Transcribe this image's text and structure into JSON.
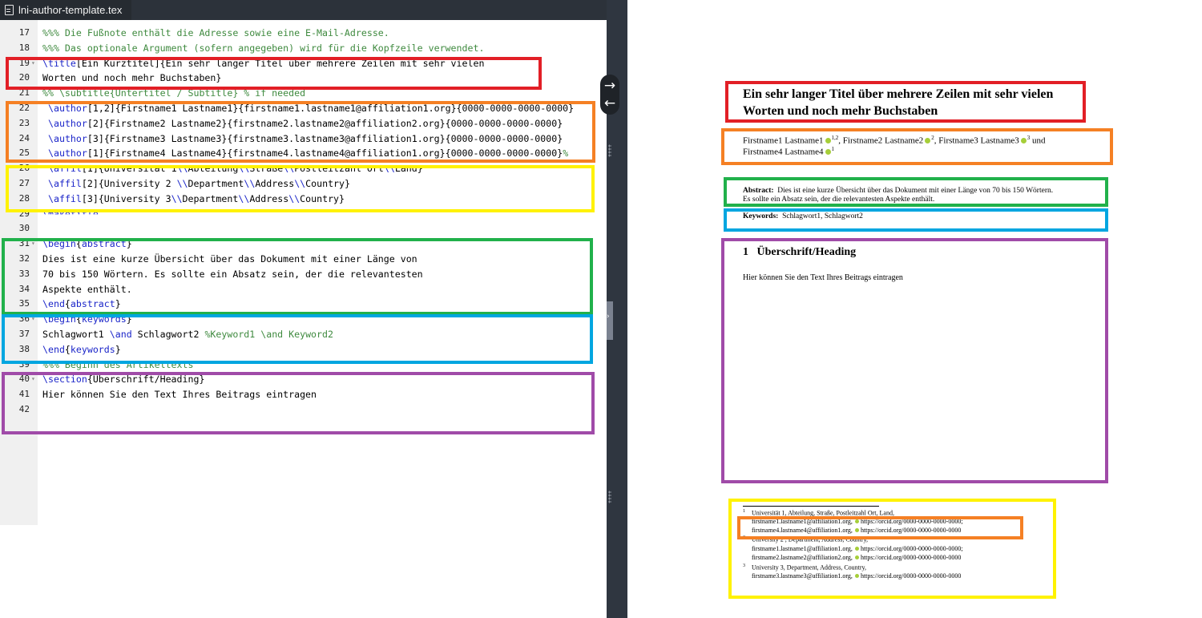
{
  "editor": {
    "tab_title": "lni-author-template.tex",
    "lines": [
      {
        "n": "17",
        "parts": [
          {
            "t": "%%% Die Fußnote enthält die Adresse sowie eine E-Mail-Adresse.",
            "c": "cm"
          }
        ]
      },
      {
        "n": "18",
        "parts": [
          {
            "t": "%%% Das optionale Argument (sofern angegeben) wird für die Kopfzeile verwendet.",
            "c": "cm"
          }
        ]
      },
      {
        "n": "19",
        "fold": true,
        "parts": [
          {
            "t": "\\title",
            "c": "kw"
          },
          {
            "t": "[Ein Kurztitel]{Ein sehr langer Titel über mehrere Zeilen mit sehr vielen"
          }
        ]
      },
      {
        "n": "20",
        "parts": [
          {
            "t": "Worten und noch mehr Buchstaben}"
          }
        ]
      },
      {
        "n": "21",
        "parts": [
          {
            "t": "%% \\subtitle{Untertitel / Subtitle} % if needed",
            "c": "cm"
          }
        ]
      },
      {
        "n": "22",
        "ind": true,
        "parts": [
          {
            "t": "\\author",
            "c": "kw"
          },
          {
            "t": "[1,2]{Firstname1 Lastname1}{firstname1.lastname1@affiliation1.org}{0000-0000-0000-0000}"
          }
        ]
      },
      {
        "n": "23",
        "ind": true,
        "parts": [
          {
            "t": "\\author",
            "c": "kw"
          },
          {
            "t": "[2]{Firstname2 Lastname2}{firstname2.lastname2@affiliation2.org}{0000-0000-0000-0000}"
          }
        ]
      },
      {
        "n": "24",
        "ind": true,
        "parts": [
          {
            "t": "\\author",
            "c": "kw"
          },
          {
            "t": "[3]{Firstname3 Lastname3}{firstname3.lastname3@affiliation1.org}{0000-0000-0000-0000}"
          }
        ]
      },
      {
        "n": "25",
        "ind": true,
        "parts": [
          {
            "t": "\\author",
            "c": "kw"
          },
          {
            "t": "[1]{Firstname4 Lastname4}{firstname4.lastname4@affiliation1.org}{0000-0000-0000-0000}"
          },
          {
            "t": "%",
            "c": "cm"
          }
        ]
      },
      {
        "n": "26",
        "ind": true,
        "cut": true,
        "parts": [
          {
            "t": "\\affil",
            "c": "kw"
          },
          {
            "t": "[1]{Universität 1"
          },
          {
            "t": "\\\\",
            "c": "kw"
          },
          {
            "t": "Abteilung"
          },
          {
            "t": "\\\\",
            "c": "kw"
          },
          {
            "t": "Straße"
          },
          {
            "t": "\\\\",
            "c": "kw"
          },
          {
            "t": "Postleitzahl Ort"
          },
          {
            "t": "\\\\",
            "c": "kw"
          },
          {
            "t": "Land}"
          }
        ]
      },
      {
        "n": "27",
        "ind": true,
        "parts": [
          {
            "t": "\\affil",
            "c": "kw"
          },
          {
            "t": "[2]{University 2 "
          },
          {
            "t": "\\\\",
            "c": "kw"
          },
          {
            "t": "Department"
          },
          {
            "t": "\\\\",
            "c": "kw"
          },
          {
            "t": "Address"
          },
          {
            "t": "\\\\",
            "c": "kw"
          },
          {
            "t": "Country}"
          }
        ]
      },
      {
        "n": "28",
        "ind": true,
        "parts": [
          {
            "t": "\\affil",
            "c": "kw"
          },
          {
            "t": "[3]{University 3"
          },
          {
            "t": "\\\\",
            "c": "kw"
          },
          {
            "t": "Department"
          },
          {
            "t": "\\\\",
            "c": "kw"
          },
          {
            "t": "Address"
          },
          {
            "t": "\\\\",
            "c": "kw"
          },
          {
            "t": "Country}"
          }
        ]
      },
      {
        "n": "29",
        "cutb": true,
        "parts": [
          {
            "t": "\\maketitle",
            "c": "kw"
          }
        ]
      },
      {
        "n": "30",
        "parts": []
      },
      {
        "n": "31",
        "fold": true,
        "parts": [
          {
            "t": "\\begin",
            "c": "kw"
          },
          {
            "t": "{"
          },
          {
            "t": "abstract",
            "c": "kw"
          },
          {
            "t": "}"
          }
        ]
      },
      {
        "n": "32",
        "parts": [
          {
            "t": "Dies ist eine kurze Übersicht über das Dokument mit einer Länge von"
          }
        ]
      },
      {
        "n": "33",
        "parts": [
          {
            "t": "70 bis 150 Wörtern. Es sollte ein Absatz sein, der die relevantesten"
          }
        ]
      },
      {
        "n": "34",
        "parts": [
          {
            "t": "Aspekte enthält."
          }
        ]
      },
      {
        "n": "35",
        "parts": [
          {
            "t": "\\end",
            "c": "kw"
          },
          {
            "t": "{"
          },
          {
            "t": "abstract",
            "c": "kw"
          },
          {
            "t": "}"
          }
        ]
      },
      {
        "n": "36",
        "fold": true,
        "parts": [
          {
            "t": "\\begin",
            "c": "kw"
          },
          {
            "t": "{"
          },
          {
            "t": "keywords",
            "c": "kw"
          },
          {
            "t": "}"
          }
        ]
      },
      {
        "n": "37",
        "parts": [
          {
            "t": "Schlagwort1 "
          },
          {
            "t": "\\and",
            "c": "kw"
          },
          {
            "t": " Schlagwort2 "
          },
          {
            "t": "%Keyword1 \\and Keyword2",
            "c": "cm"
          }
        ]
      },
      {
        "n": "38",
        "parts": [
          {
            "t": "\\end",
            "c": "kw"
          },
          {
            "t": "{"
          },
          {
            "t": "keywords",
            "c": "kw"
          },
          {
            "t": "}"
          }
        ]
      },
      {
        "n": "39",
        "cut": true,
        "parts": [
          {
            "t": "%%% Beginn des Artikeltexts",
            "c": "cm"
          }
        ]
      },
      {
        "n": "40",
        "fold": true,
        "parts": [
          {
            "t": "\\section",
            "c": "kw"
          },
          {
            "t": "{Überschrift/Heading}"
          }
        ]
      },
      {
        "n": "41",
        "parts": [
          {
            "t": "Hier können Sie den Text Ihres Beitrags eintragen"
          }
        ]
      },
      {
        "n": "42",
        "parts": []
      }
    ]
  },
  "divider": {
    "arrow_right": "→",
    "arrow_left": "←",
    "collapse_glyph": "›"
  },
  "preview": {
    "title_line1": "Ein sehr langer Titel über mehrere Zeilen mit sehr vielen",
    "title_line2": "Worten und noch mehr Buchstaben",
    "authors": [
      {
        "name": "Firstname1 Lastname1",
        "sup": "1,2",
        "sep": ", "
      },
      {
        "name": "Firstname2 Lastname2",
        "sup": "2",
        "sep": ", "
      },
      {
        "name": "Firstname3 Lastname3",
        "sup": "3",
        "sep": " und"
      },
      {
        "name": "Firstname4 Lastname4",
        "sup": "1",
        "sep": ""
      }
    ],
    "abstract_label": "Abstract:",
    "abstract_line1": "Dies ist eine kurze Übersicht über das Dokument mit einer Länge von 70 bis 150 Wörtern.",
    "abstract_line2": "Es sollte ein Absatz sein, der die relevantesten Aspekte enthält.",
    "keywords_label": "Keywords:",
    "keywords_text": "Schlagwort1, Schlagwort2",
    "section_number": "1",
    "section_title": "Überschrift/Heading",
    "body_text": "Hier können Sie den Text Ihres Beitrags eintragen",
    "footnotes": [
      {
        "mark": "1",
        "text": "Universität 1, Abteilung, Straße, Postleitzahl Ort, Land,",
        "mark_top": true
      },
      {
        "mark": "",
        "text": "firstname1.lastname1@affiliation1.org, ",
        "url": "https://orcid.org/0000-0000-0000-0000;"
      },
      {
        "mark": "",
        "text": "firstname4.lastname4@affiliation1.org, ",
        "url": "https://orcid.org/0000-0000-0000-0000"
      },
      {
        "mark": "2",
        "text": "University 2 , Department, Address, Country,",
        "mark_top": true
      },
      {
        "mark": "",
        "text": "firstname1.lastname1@affiliation1.org, ",
        "url": "https://orcid.org/0000-0000-0000-0000;"
      },
      {
        "mark": "",
        "text": "firstname2.lastname2@affiliation2.org, ",
        "url": "https://orcid.org/0000-0000-0000-0000"
      },
      {
        "mark": "3",
        "text": "University 3, Department, Address, Country,",
        "mark_top": true
      },
      {
        "mark": "",
        "text": "firstname3.lastname3@affiliation1.org, ",
        "url": "https://orcid.org/0000-0000-0000-0000"
      }
    ]
  },
  "colors": {
    "red": "#e21f26",
    "orange": "#f58024",
    "yellow": "#fff200",
    "green": "#21b14b",
    "blue": "#00a6e0",
    "purple": "#a04ba8",
    "orcid": "#a6ce39",
    "keyword": "#1b25c9",
    "comment": "#3f8a3f"
  }
}
